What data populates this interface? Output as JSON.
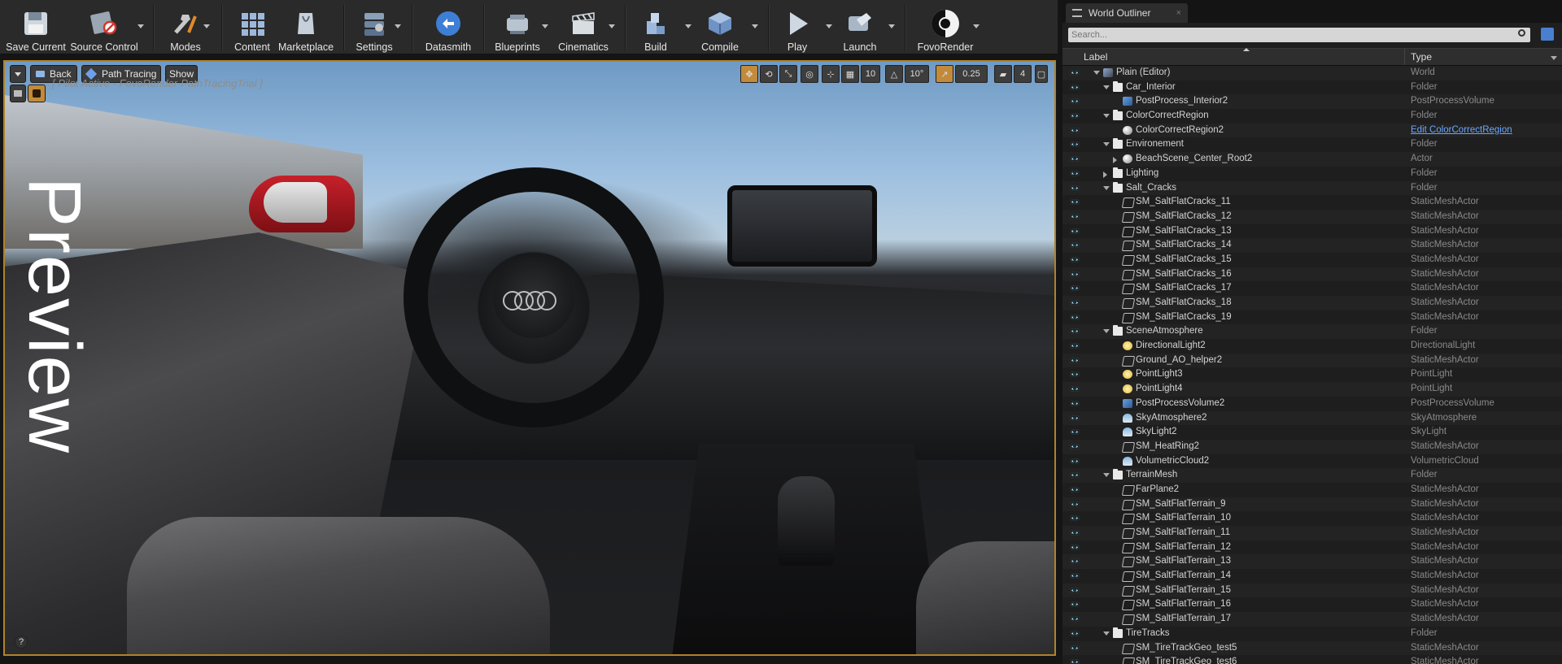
{
  "toolbar": {
    "buttons": [
      {
        "label": "Save Current",
        "icon": "save-icon"
      },
      {
        "label": "Source Control",
        "icon": "source-control-icon"
      },
      {
        "label": "Modes",
        "icon": "modes-icon"
      },
      {
        "label": "Content",
        "icon": "content-icon"
      },
      {
        "label": "Marketplace",
        "icon": "marketplace-icon"
      },
      {
        "label": "Settings",
        "icon": "settings-icon"
      },
      {
        "label": "Datasmith",
        "icon": "datasmith-icon"
      },
      {
        "label": "Blueprints",
        "icon": "blueprints-icon"
      },
      {
        "label": "Cinematics",
        "icon": "cinematics-icon"
      },
      {
        "label": "Build",
        "icon": "build-icon"
      },
      {
        "label": "Compile",
        "icon": "compile-icon"
      },
      {
        "label": "Play",
        "icon": "play-icon"
      },
      {
        "label": "Launch",
        "icon": "launch-icon"
      },
      {
        "label": "FovoRender",
        "icon": "fovorender-icon"
      }
    ]
  },
  "viewport": {
    "back_label": "Back",
    "view_mode_label": "Path Tracing",
    "show_label": "Show",
    "pilot_text": "[ Pilot Active - FovoRender-PathTracingTrial ]",
    "preview_label": "Preview",
    "grid_snap": "10",
    "rotation_snap": "10°",
    "scale_snap": "0.25",
    "camera_speed": "4"
  },
  "outliner": {
    "tab_title": "World Outliner",
    "search_placeholder": "Search...",
    "col_label": "Label",
    "col_type": "Type",
    "rows": [
      {
        "label": "Plain (Editor)",
        "type": "World",
        "indent": 0,
        "icon": "world",
        "exp": "open"
      },
      {
        "label": "Car_Interior",
        "type": "Folder",
        "indent": 1,
        "icon": "folder",
        "exp": "open"
      },
      {
        "label": "PostProcess_Interior2",
        "type": "PostProcessVolume",
        "indent": 2,
        "icon": "pp",
        "exp": ""
      },
      {
        "label": "ColorCorrectRegion",
        "type": "Folder",
        "indent": 1,
        "icon": "folder",
        "exp": "open"
      },
      {
        "label": "ColorCorrectRegion2",
        "type": "Edit ColorCorrectRegion",
        "indent": 2,
        "icon": "sphere",
        "exp": "",
        "link": true
      },
      {
        "label": "Environement",
        "type": "Folder",
        "indent": 1,
        "icon": "folder",
        "exp": "open"
      },
      {
        "label": "BeachScene_Center_Root2",
        "type": "Actor",
        "indent": 2,
        "icon": "sphere",
        "exp": "closed"
      },
      {
        "label": "Lighting",
        "type": "Folder",
        "indent": 1,
        "icon": "folder",
        "exp": "closed"
      },
      {
        "label": "Salt_Cracks",
        "type": "Folder",
        "indent": 1,
        "icon": "folder",
        "exp": "open"
      },
      {
        "label": "SM_SaltFlatCracks_11",
        "type": "StaticMeshActor",
        "indent": 2,
        "icon": "mesh",
        "exp": ""
      },
      {
        "label": "SM_SaltFlatCracks_12",
        "type": "StaticMeshActor",
        "indent": 2,
        "icon": "mesh",
        "exp": ""
      },
      {
        "label": "SM_SaltFlatCracks_13",
        "type": "StaticMeshActor",
        "indent": 2,
        "icon": "mesh",
        "exp": ""
      },
      {
        "label": "SM_SaltFlatCracks_14",
        "type": "StaticMeshActor",
        "indent": 2,
        "icon": "mesh",
        "exp": ""
      },
      {
        "label": "SM_SaltFlatCracks_15",
        "type": "StaticMeshActor",
        "indent": 2,
        "icon": "mesh",
        "exp": ""
      },
      {
        "label": "SM_SaltFlatCracks_16",
        "type": "StaticMeshActor",
        "indent": 2,
        "icon": "mesh",
        "exp": ""
      },
      {
        "label": "SM_SaltFlatCracks_17",
        "type": "StaticMeshActor",
        "indent": 2,
        "icon": "mesh",
        "exp": ""
      },
      {
        "label": "SM_SaltFlatCracks_18",
        "type": "StaticMeshActor",
        "indent": 2,
        "icon": "mesh",
        "exp": ""
      },
      {
        "label": "SM_SaltFlatCracks_19",
        "type": "StaticMeshActor",
        "indent": 2,
        "icon": "mesh",
        "exp": ""
      },
      {
        "label": "SceneAtmosphere",
        "type": "Folder",
        "indent": 1,
        "icon": "folder",
        "exp": "open"
      },
      {
        "label": "DirectionalLight2",
        "type": "DirectionalLight",
        "indent": 2,
        "icon": "light",
        "exp": ""
      },
      {
        "label": "Ground_AO_helper2",
        "type": "StaticMeshActor",
        "indent": 2,
        "icon": "mesh",
        "exp": ""
      },
      {
        "label": "PointLight3",
        "type": "PointLight",
        "indent": 2,
        "icon": "light",
        "exp": ""
      },
      {
        "label": "PointLight4",
        "type": "PointLight",
        "indent": 2,
        "icon": "light",
        "exp": ""
      },
      {
        "label": "PostProcessVolume2",
        "type": "PostProcessVolume",
        "indent": 2,
        "icon": "pp",
        "exp": ""
      },
      {
        "label": "SkyAtmosphere2",
        "type": "SkyAtmosphere",
        "indent": 2,
        "icon": "sky",
        "exp": ""
      },
      {
        "label": "SkyLight2",
        "type": "SkyLight",
        "indent": 2,
        "icon": "sky",
        "exp": ""
      },
      {
        "label": "SM_HeatRing2",
        "type": "StaticMeshActor",
        "indent": 2,
        "icon": "mesh",
        "exp": ""
      },
      {
        "label": "VolumetricCloud2",
        "type": "VolumetricCloud",
        "indent": 2,
        "icon": "sky",
        "exp": ""
      },
      {
        "label": "TerrainMesh",
        "type": "Folder",
        "indent": 1,
        "icon": "folder",
        "exp": "open"
      },
      {
        "label": "FarPlane2",
        "type": "StaticMeshActor",
        "indent": 2,
        "icon": "mesh",
        "exp": ""
      },
      {
        "label": "SM_SaltFlatTerrain_9",
        "type": "StaticMeshActor",
        "indent": 2,
        "icon": "mesh",
        "exp": ""
      },
      {
        "label": "SM_SaltFlatTerrain_10",
        "type": "StaticMeshActor",
        "indent": 2,
        "icon": "mesh",
        "exp": ""
      },
      {
        "label": "SM_SaltFlatTerrain_11",
        "type": "StaticMeshActor",
        "indent": 2,
        "icon": "mesh",
        "exp": ""
      },
      {
        "label": "SM_SaltFlatTerrain_12",
        "type": "StaticMeshActor",
        "indent": 2,
        "icon": "mesh",
        "exp": ""
      },
      {
        "label": "SM_SaltFlatTerrain_13",
        "type": "StaticMeshActor",
        "indent": 2,
        "icon": "mesh",
        "exp": ""
      },
      {
        "label": "SM_SaltFlatTerrain_14",
        "type": "StaticMeshActor",
        "indent": 2,
        "icon": "mesh",
        "exp": ""
      },
      {
        "label": "SM_SaltFlatTerrain_15",
        "type": "StaticMeshActor",
        "indent": 2,
        "icon": "mesh",
        "exp": ""
      },
      {
        "label": "SM_SaltFlatTerrain_16",
        "type": "StaticMeshActor",
        "indent": 2,
        "icon": "mesh",
        "exp": ""
      },
      {
        "label": "SM_SaltFlatTerrain_17",
        "type": "StaticMeshActor",
        "indent": 2,
        "icon": "mesh",
        "exp": ""
      },
      {
        "label": "TireTracks",
        "type": "Folder",
        "indent": 1,
        "icon": "folder",
        "exp": "open"
      },
      {
        "label": "SM_TireTrackGeo_test5",
        "type": "StaticMeshActor",
        "indent": 2,
        "icon": "mesh",
        "exp": ""
      },
      {
        "label": "SM_TireTrackGeo_test6",
        "type": "StaticMeshActor",
        "indent": 2,
        "icon": "mesh",
        "exp": ""
      }
    ]
  },
  "colors": {
    "accent": "#b0822a",
    "link": "#6aa7ff",
    "panel": "#1f1f1f"
  }
}
